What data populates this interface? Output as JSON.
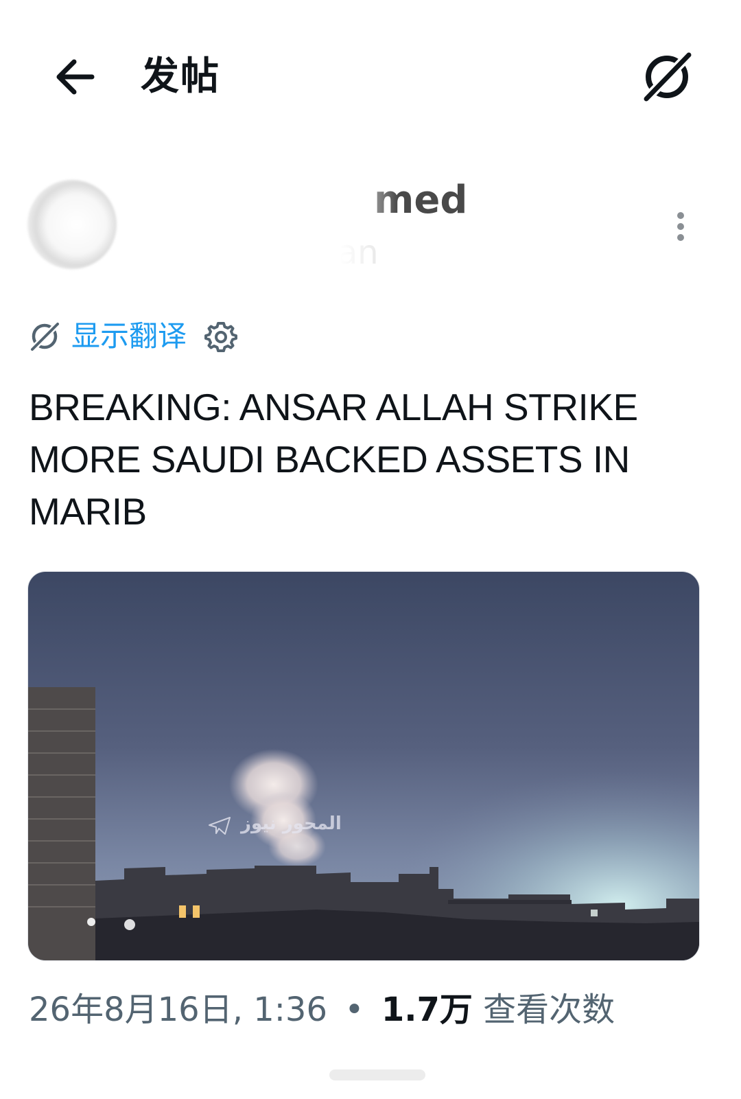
{
  "header": {
    "title": "发帖"
  },
  "author": {
    "name_visible": "med",
    "handle_visible": "man"
  },
  "translate": {
    "label": "显示翻译"
  },
  "post": {
    "text": "BREAKING: ANSAR ALLAH STRIKE MORE SAUDI BACKED ASSETS IN MARIB"
  },
  "media": {
    "watermark_text": "المحور نيوز"
  },
  "meta": {
    "date": "26年8月16日, 1:36",
    "separator": "•",
    "views_count": "1.7万",
    "views_label": "查看次数"
  },
  "colors": {
    "link": "#1d9bf0",
    "text": "#0f1419",
    "secondary": "#536471"
  },
  "icons": {
    "back": "arrow-left-icon",
    "header_action": "grok-slash-circle-icon",
    "more": "vertical-ellipsis-icon",
    "translate": "grok-slash-circle-icon",
    "settings": "gear-icon"
  }
}
